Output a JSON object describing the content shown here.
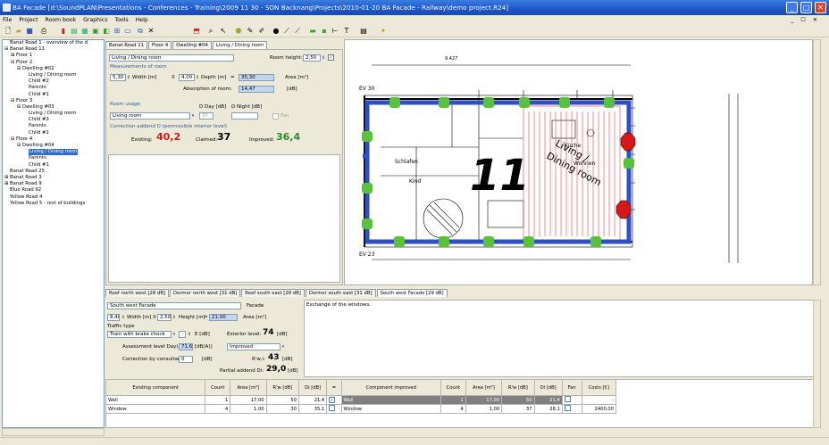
{
  "window": {
    "title": "BA Facade  [d:\\SoundPLAN\\Presentations - Conferences - Training\\2009 11 30 - SON Backnang\\Projects\\2010-01-20 BA Facade - Railway\\demo project.R24]",
    "min": "_",
    "max": "□",
    "close": "✕"
  },
  "menu": [
    "File",
    "Project",
    "Room book",
    "Graphics",
    "Tools",
    "Help"
  ],
  "mdi_controls": "_ ☐ ✕",
  "tree": [
    {
      "label": "Banat Road 1 - overview of the d",
      "indent": 0,
      "sign": ""
    },
    {
      "label": "Banat Road 11",
      "indent": 0,
      "sign": "⊟"
    },
    {
      "label": "Floor 1",
      "indent": 1,
      "sign": "⊞"
    },
    {
      "label": "Floor 2",
      "indent": 1,
      "sign": "⊟"
    },
    {
      "label": "Dwelling #02",
      "indent": 2,
      "sign": "⊟"
    },
    {
      "label": "Living / Dining room",
      "indent": 3,
      "sign": ""
    },
    {
      "label": "Child #2",
      "indent": 3,
      "sign": ""
    },
    {
      "label": "Parents",
      "indent": 3,
      "sign": ""
    },
    {
      "label": "Child #1",
      "indent": 3,
      "sign": ""
    },
    {
      "label": "Floor 3",
      "indent": 1,
      "sign": "⊟"
    },
    {
      "label": "Dwelling #03",
      "indent": 2,
      "sign": "⊟"
    },
    {
      "label": "Living / Dining room",
      "indent": 3,
      "sign": ""
    },
    {
      "label": "Child #2",
      "indent": 3,
      "sign": ""
    },
    {
      "label": "Parents",
      "indent": 3,
      "sign": ""
    },
    {
      "label": "Child #1",
      "indent": 3,
      "sign": ""
    },
    {
      "label": "Floor 4",
      "indent": 1,
      "sign": "⊟"
    },
    {
      "label": "Dwelling #04",
      "indent": 2,
      "sign": "⊟"
    },
    {
      "label": "Living / Dining room",
      "indent": 3,
      "sign": "",
      "selected": true
    },
    {
      "label": "Parents",
      "indent": 3,
      "sign": ""
    },
    {
      "label": "Child #1",
      "indent": 3,
      "sign": ""
    },
    {
      "label": "Banat Road 25",
      "indent": 0,
      "sign": ""
    },
    {
      "label": "Banat Road 3",
      "indent": 0,
      "sign": "⊞"
    },
    {
      "label": "Banat Road 9",
      "indent": 0,
      "sign": "⊞"
    },
    {
      "label": "Blue Road 92",
      "indent": 0,
      "sign": ""
    },
    {
      "label": "Yellow Road 4",
      "indent": 0,
      "sign": ""
    },
    {
      "label": "Yellow Road 5 - rest of buildings",
      "indent": 0,
      "sign": ""
    }
  ],
  "top_tabs": [
    "Banat Road 11",
    "Floor 4",
    "Dwelling #04",
    "Living / Dining room"
  ],
  "room": {
    "name": "Living / Dining room",
    "height_label": "Room height:",
    "height_value": "2,50",
    "measurements_title": "Measurements of room",
    "width_value": "5,30",
    "width_label": "Width [m]",
    "x": "X",
    "depth_value": "4,00",
    "depth_label": "Depth [m]",
    "eq": "=",
    "area_value": "35,30",
    "area_label": "Area [m²]",
    "absorption_label": "Absorption of room:",
    "absorption_value": "14,47",
    "absorption_unit": "[dB]",
    "usage_title": "Room usage",
    "dday_label": "D Day [dB]",
    "dnight_label": "D Night [dB]",
    "usage_value": "Living room",
    "dday_value": "37",
    "fan_label": "Fan",
    "correction_title": "Correction addend D (permissible interior level)",
    "existing_label": "Existing:",
    "existing_value": "40,2",
    "claimed_label": "Claimed:",
    "claimed_value": "37",
    "improved_label": "Improved:",
    "improved_value": "36,4"
  },
  "drawing_labels": {
    "living": "Living /",
    "dining": "Dining room",
    "big_number": "11",
    "scale": "9.427",
    "ev30": "EV 30",
    "ev23": "EV 23",
    "kitchen": "Küche",
    "living_small": "Wohnen",
    "kind": "Kind",
    "schlafen": "Schlafen"
  },
  "bottom_tabs": [
    "Roof north west [28 dB]",
    "Dormer north west [31 dB]",
    "Roof south east [28 dB]",
    "Dormer south east [31 dB]",
    "South west Facade [29 dB]"
  ],
  "facade": {
    "name": "South west Facade",
    "type_label": "Facade",
    "width_value": "8,40",
    "width_label": "Width [m]",
    "x": "X",
    "height_value": "2,50",
    "height_label": "Height [m]",
    "eq": "=",
    "area_value": "21,00",
    "area_label": "Area [m²]",
    "traffic_label": "Traffic type",
    "traffic_value": "Train with brake chock",
    "traffic_num": "-",
    "e_label": "E [dB]",
    "exterior_label": "Exterior level:",
    "exterior_value": "74",
    "exterior_unit": "[dB]",
    "assessment_label": "Assessment level Day(A):",
    "assessment_value": "71,6",
    "assessment_unit": "[dB(A)]",
    "assess_mode": "Improved",
    "correction_label": "Correction by consultant:",
    "correction_value": "0",
    "correction_unit": "[dB]",
    "rw_label": "R'w,i:",
    "rw_value": "43",
    "rw_unit": "[dB]",
    "partial_label": "Partial addend Di:",
    "partial_value": "29,0",
    "partial_unit": "[dB]",
    "note": "Exchange of the windows."
  },
  "table": {
    "headers": [
      "Existing component",
      "Count",
      "Area [m²]",
      "R'w [dB]",
      "Di [dB]",
      "=",
      "Component improved",
      "Count",
      "Area [m²]",
      "R'w [dB]",
      "Di [dB]",
      "Fan",
      "Costs [€]"
    ],
    "rows": [
      [
        "Wall",
        "1",
        "17,00",
        "50",
        "21,4",
        "",
        "Wall",
        "1",
        "17,00",
        "50",
        "21,4",
        "",
        "-"
      ],
      [
        "Window",
        "4",
        "1,00",
        "30",
        "35,1",
        "",
        "Window",
        "4",
        "1,00",
        "37",
        "28,1",
        "",
        "2400,00"
      ]
    ]
  },
  "colors": {
    "accent": "#2d5ba8",
    "existing": "#d11b1b",
    "improved": "#2a8c2a",
    "wall": "#2f4fc4",
    "node": "#58c23a",
    "hotspot": "#d61818"
  }
}
